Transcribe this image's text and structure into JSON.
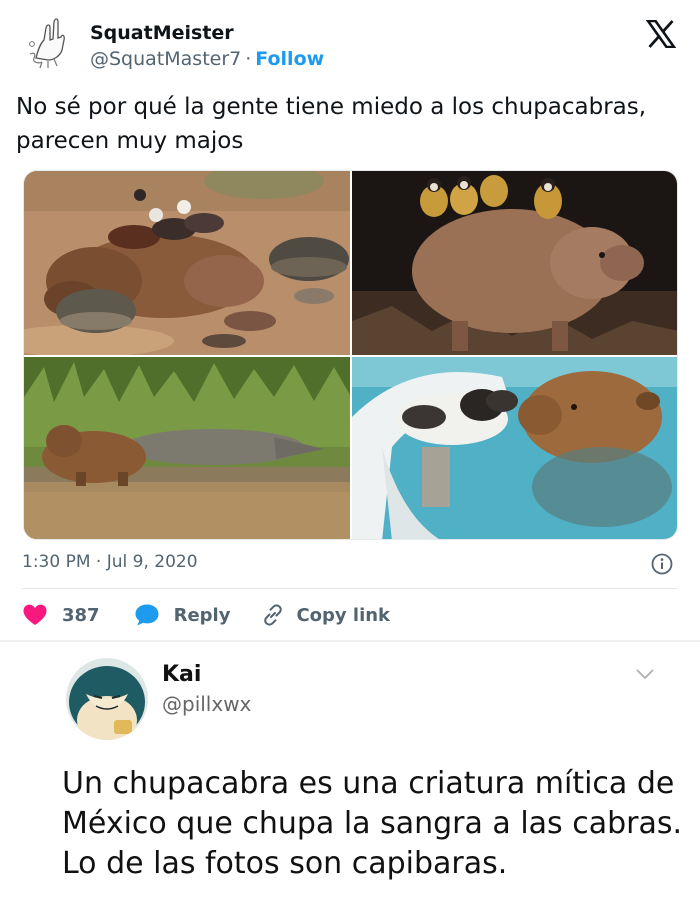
{
  "tweet": {
    "display_name": "SquatMeister",
    "handle": "@SquatMaster7",
    "separator": "·",
    "follow_label": "Follow",
    "text": "No sé por qué la gente tiene miedo a los chupacabras, parecen muy majos",
    "timestamp": "1:30 PM · Jul 9, 2020",
    "like_count": "387",
    "reply_label": "Reply",
    "copy_link_label": "Copy link",
    "brand_icon": "x-logo-icon",
    "colors": {
      "accent": "#1d9bf0",
      "heart": "#f91880",
      "muted": "#536471",
      "text": "#0f1419"
    }
  },
  "media": {
    "photos": [
      {
        "name": "capybara-with-ducks-and-turtles-photo"
      },
      {
        "name": "capybara-with-monkeys-photo"
      },
      {
        "name": "capybara-with-caiman-photo"
      },
      {
        "name": "capybara-with-rat-in-pool-photo"
      }
    ]
  },
  "reply": {
    "display_name": "Kai",
    "handle": "@pillxwx",
    "text": "Un chupacabra es una criatura mítica de México que chupa la sangra a las cabras. Lo de las fotos son capibaras."
  }
}
